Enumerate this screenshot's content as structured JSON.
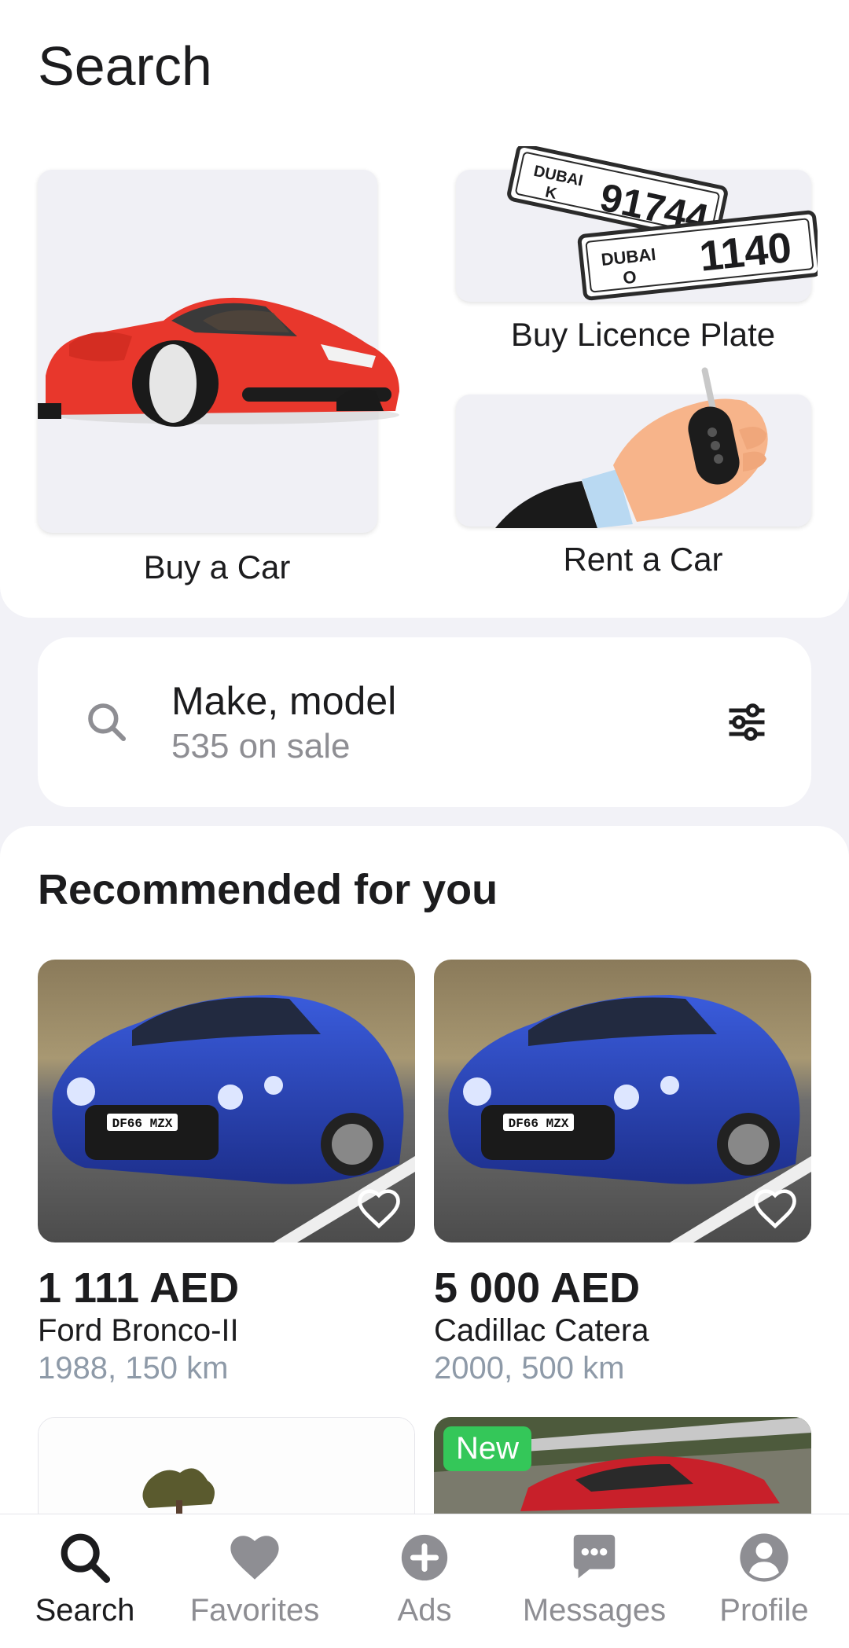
{
  "page_title": "Search",
  "categories": {
    "buy_car": "Buy a Car",
    "buy_plate": "Buy Licence Plate",
    "rent_car": "Rent a Car",
    "plate1_city": "DUBAI",
    "plate1_letter": "K",
    "plate1_number": "91744",
    "plate2_city": "DUBAI",
    "plate2_letter": "O",
    "plate2_number": "1140"
  },
  "search": {
    "title": "Make, model",
    "subtitle": "535 on sale"
  },
  "recommended": {
    "title": "Recommended for you",
    "listings": [
      {
        "price": "1 111 AED",
        "model": "Ford Bronco-II",
        "meta": "1988, 150 km",
        "plate": "DF66 MZX"
      },
      {
        "price": "5 000 AED",
        "model": "Cadillac Catera",
        "meta": "2000, 500 km",
        "plate": "DF66 MZX"
      }
    ],
    "badge_new": "New"
  },
  "nav": {
    "items": [
      {
        "label": "Search",
        "icon": "search-icon"
      },
      {
        "label": "Favorites",
        "icon": "heart-icon"
      },
      {
        "label": "Ads",
        "icon": "plus-circle-icon"
      },
      {
        "label": "Messages",
        "icon": "chat-icon"
      },
      {
        "label": "Profile",
        "icon": "profile-icon"
      }
    ]
  },
  "colors": {
    "background": "#f2f2f7",
    "accent_green": "#34c759",
    "car_red": "#e8372c",
    "car_blue": "#2a49c9"
  }
}
